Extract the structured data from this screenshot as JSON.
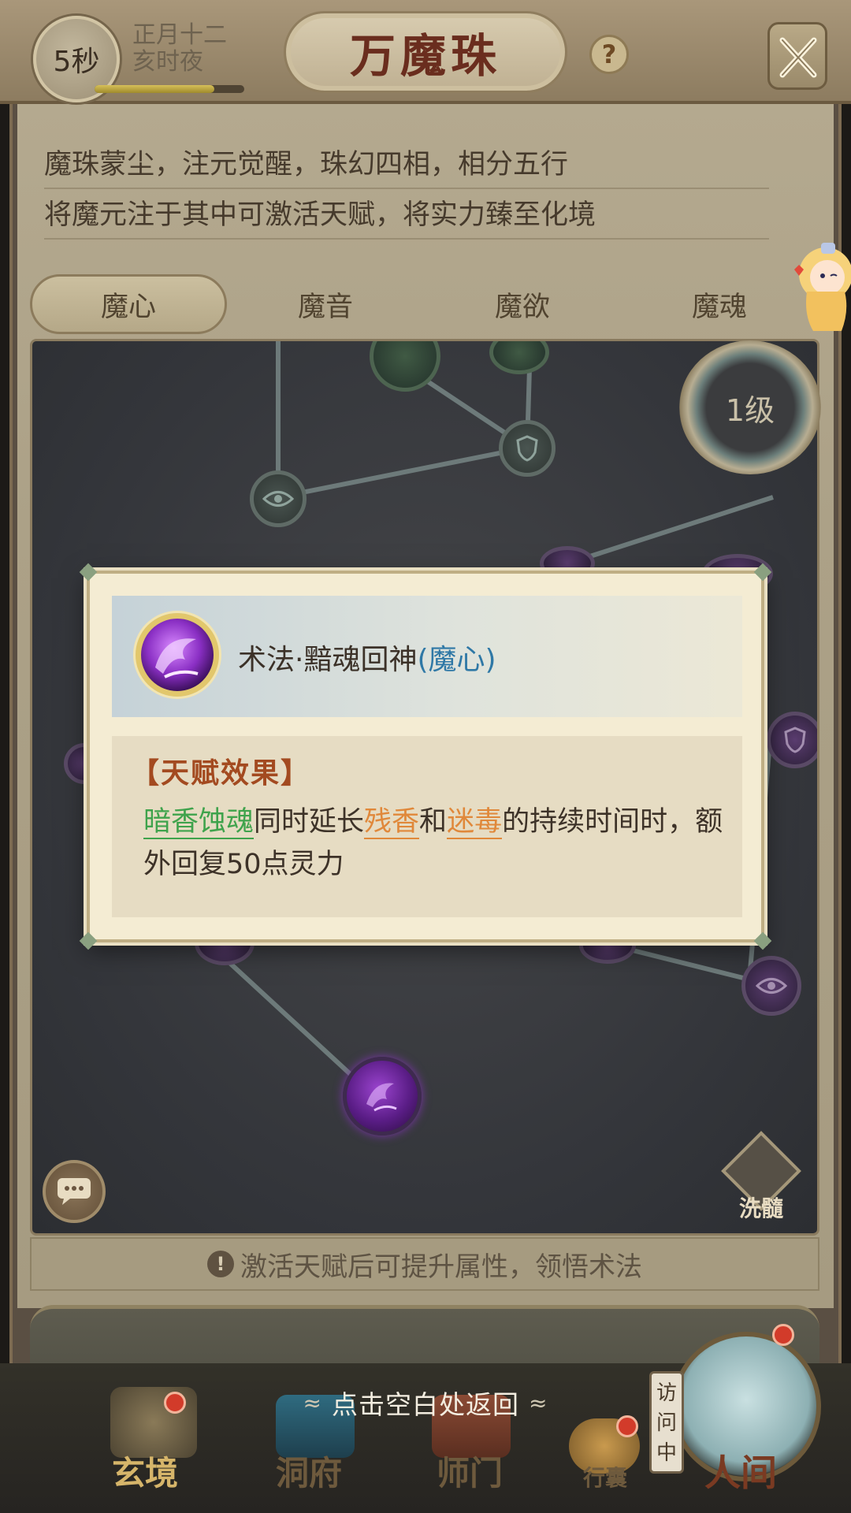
{
  "header": {
    "timer": "5秒",
    "lunar_date": "正月十二",
    "time_of_day": "亥时夜",
    "title": "万魔珠",
    "help_symbol": "?"
  },
  "intro": {
    "line1": "魔珠蒙尘，注元觉醒，珠幻四相，相分五行",
    "line2": "将魔元注于其中可激活天赋，将实力臻至化境"
  },
  "tabs": [
    {
      "label": "魔心",
      "active": true
    },
    {
      "label": "魔音",
      "active": false
    },
    {
      "label": "魔欲",
      "active": false
    },
    {
      "label": "魔魂",
      "active": false
    }
  ],
  "board": {
    "level": "1级",
    "wash_label": "洗髓"
  },
  "hint": "激活天赋后可提升属性，领悟术法",
  "return_hint": "点击空白处返回",
  "popup": {
    "skill_name": "术法·黯魂回神",
    "skill_tag": "(魔心)",
    "effect_header": "【天赋效果】",
    "effect": {
      "kw1": "暗香蚀魂",
      "t1": "同时延长",
      "kw2": "残香",
      "t2": "和",
      "kw3": "迷毒",
      "t3": "的持续时间时，额外回复50点灵力"
    }
  },
  "dock": {
    "items": [
      "玄境",
      "洞府",
      "师门",
      "行囊",
      "人间"
    ],
    "visiting": "访问中"
  },
  "colors": {
    "title": "#6a2d1e",
    "keyword_green": "#3fa34c",
    "keyword_orange": "#e0883a",
    "tag_blue": "#2f78a6",
    "effect_header": "#a34a20"
  }
}
